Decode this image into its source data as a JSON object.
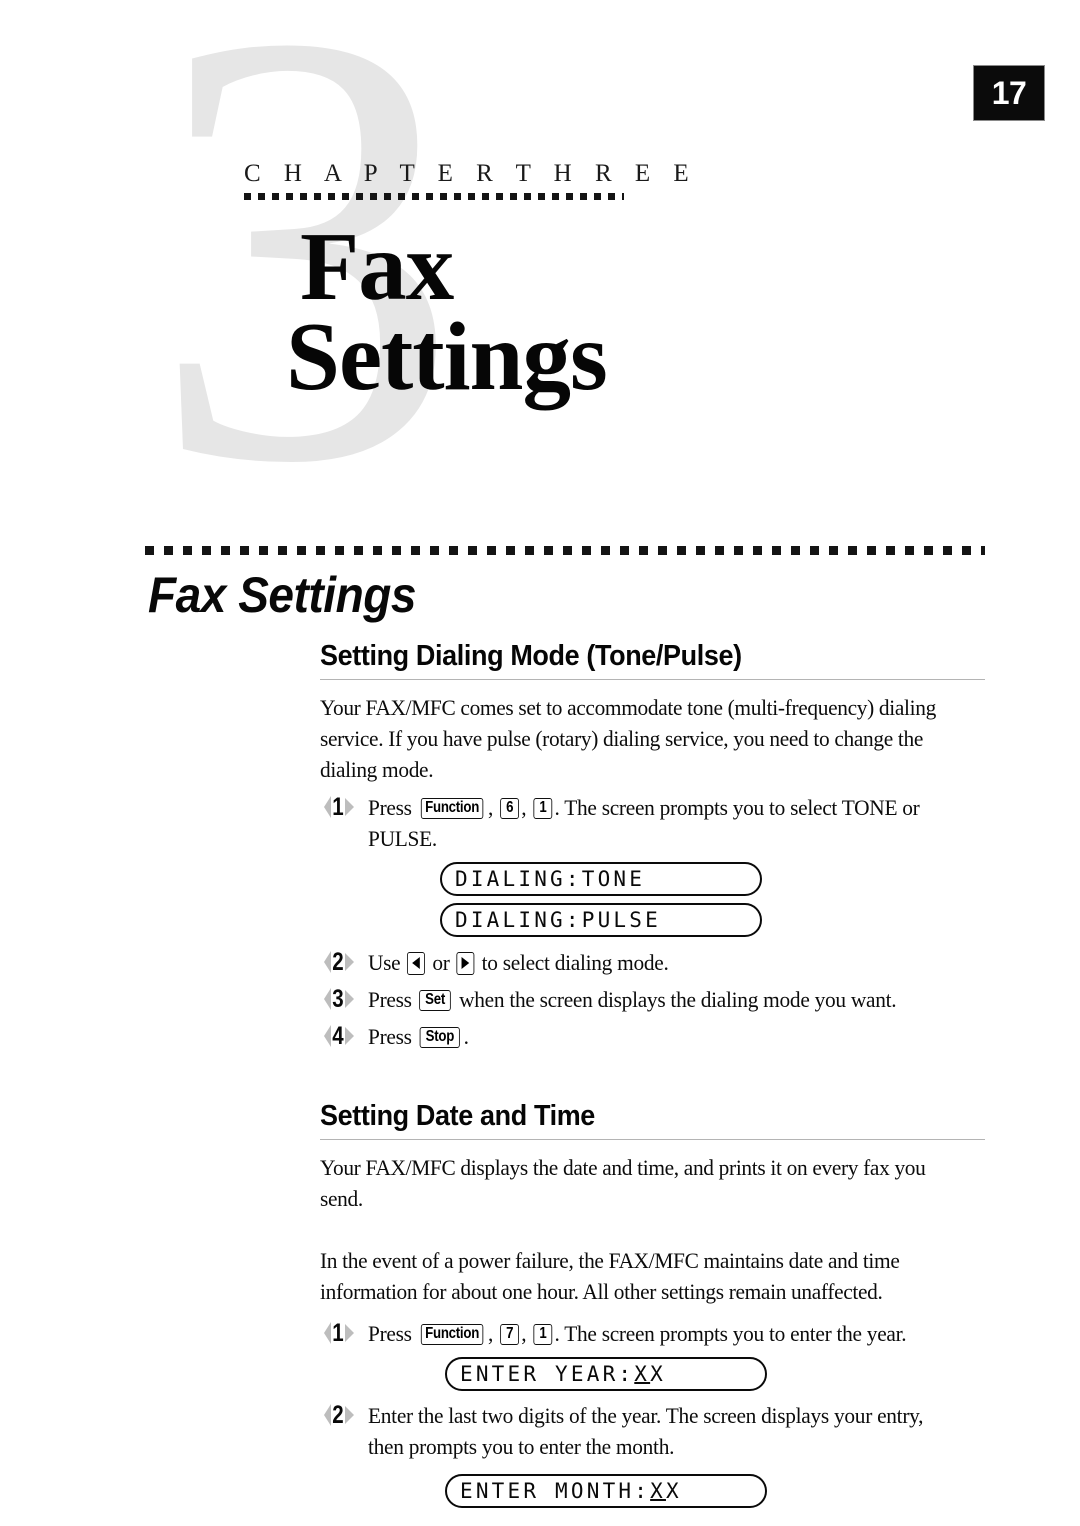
{
  "page": {
    "number": "17"
  },
  "watermark": {
    "numeral": "3",
    "color": "#e6e6e6"
  },
  "chapter": {
    "eyebrow": "C H A P T E R   T H R E E",
    "title_line1": "Fax",
    "title_line2": "Settings"
  },
  "running_head": "Fax Settings",
  "sections": [
    {
      "heading": "Setting Dialing Mode (Tone/Pulse)",
      "intro": "Your FAX/MFC comes set to accommodate tone (multi-frequency) dialing service. If you have pulse (rotary) dialing service, you need to change the dialing mode.",
      "steps": [
        {
          "number": "1",
          "text_before": "Press",
          "keys": [
            "Function",
            "6",
            "1"
          ],
          "text_after": ". The screen prompts you to select TONE or PULSE."
        },
        {
          "number": "2",
          "text_before": "Use",
          "key_left": "left-arrow",
          "text_middle": "or",
          "key_right": "right-arrow",
          "text_after": "to select dialing mode."
        },
        {
          "number": "3",
          "text_before": "Press",
          "keys": [
            "Set"
          ],
          "text_after": "when the screen displays the dialing mode you want."
        },
        {
          "number": "4",
          "text_before": "Press",
          "keys": [
            "Stop"
          ],
          "text_after": "."
        }
      ],
      "lcd_displays": [
        {
          "text": "DIALING:TONE",
          "cursor": ""
        },
        {
          "text": "DIALING:PULSE",
          "cursor": ""
        }
      ]
    },
    {
      "heading": "Setting Date and Time",
      "intro1": "Your FAX/MFC displays the date and time, and prints it on every fax you send.",
      "intro2": "In the event of a power failure, the FAX/MFC maintains date and time information for about one hour. All other settings remain unaffected.",
      "steps": [
        {
          "number": "1",
          "text_before": "Press",
          "keys": [
            "Function",
            "7",
            "1"
          ],
          "text_after": ". The screen prompts you to enter the year."
        },
        {
          "number": "2",
          "text_full": "Enter the last two digits of the year. The screen displays your entry, then prompts you to enter the month."
        }
      ],
      "lcd_displays": [
        {
          "prefix": "ENTER YEAR:",
          "cursor": "X",
          "suffix": "X"
        },
        {
          "prefix": "ENTER MONTH:",
          "cursor": "X",
          "suffix": "X"
        }
      ]
    }
  ]
}
